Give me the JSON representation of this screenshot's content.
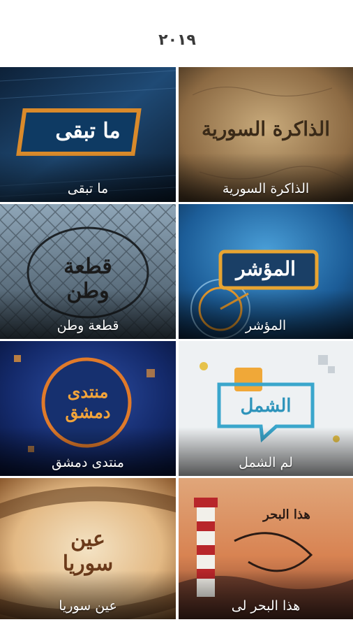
{
  "header": {
    "logo_text": "٢٠١٩"
  },
  "tiles": [
    {
      "label": "الذاكرة السورية",
      "art_title": "الذاكرة السورية",
      "icon": "old-paper-calligraphy"
    },
    {
      "label": "ما تبقى",
      "art_title": "ما تبقى",
      "icon": "framed-title"
    },
    {
      "label": "المؤشر",
      "art_title": "المؤشر",
      "icon": "compass-map"
    },
    {
      "label": "قطعة وطن",
      "art_title": "قطعة وطن",
      "icon": "barbed-wire-fence"
    },
    {
      "label": "لم الشمل",
      "art_title": "الشمل",
      "icon": "speech-bubbles"
    },
    {
      "label": "منتدى دمشق",
      "art_title": "منتدى دمشق",
      "icon": "circle-emblem"
    },
    {
      "label": "هذا البحر لى",
      "art_title": "هذا البحر",
      "icon": "lighthouse-sunset"
    },
    {
      "label": "عين سوريا",
      "art_title": "عين سوريا",
      "icon": "film-reel"
    }
  ]
}
